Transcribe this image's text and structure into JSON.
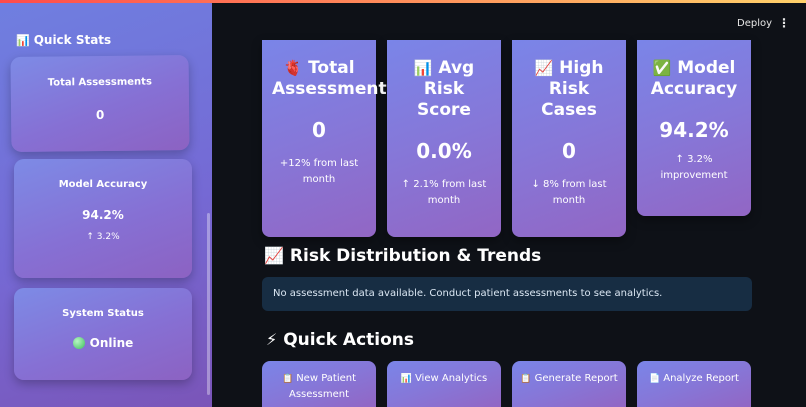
{
  "header": {
    "deploy_label": "Deploy",
    "menu_icon": "⋮"
  },
  "sidebar": {
    "title": "Quick Stats",
    "title_icon": "📊",
    "cards": [
      {
        "title": "Total Assessments",
        "value": "0"
      },
      {
        "title": "Model Accuracy",
        "value": "94.2%",
        "delta": "↑ 3.2%"
      },
      {
        "title": "System Status",
        "value": "Online"
      }
    ]
  },
  "stats": [
    {
      "icon": "🫀",
      "title": "Total Assessments",
      "value": "0",
      "delta": "+12% from last month"
    },
    {
      "icon": "📊",
      "title": "Avg Risk Score",
      "value": "0.0%",
      "delta": "↑ 2.1% from last month"
    },
    {
      "icon": "📈",
      "title": "High Risk Cases",
      "value": "0",
      "delta": "↓ 8% from last month"
    },
    {
      "icon": "✅",
      "title": "Model Accuracy",
      "value": "94.2%",
      "delta": "↑ 3.2% improvement"
    }
  ],
  "risk_section": {
    "icon": "📈",
    "title": "Risk Distribution & Trends",
    "info": "No assessment data available. Conduct patient assessments to see analytics."
  },
  "quick_actions": {
    "icon": "⚡",
    "title": "Quick Actions",
    "buttons": [
      {
        "icon": "📋",
        "label": "New Patient Assessment"
      },
      {
        "icon": "📊",
        "label": "View Analytics"
      },
      {
        "icon": "📋",
        "label": "Generate Report"
      },
      {
        "icon": "📄",
        "label": "Analyze Report"
      }
    ]
  }
}
